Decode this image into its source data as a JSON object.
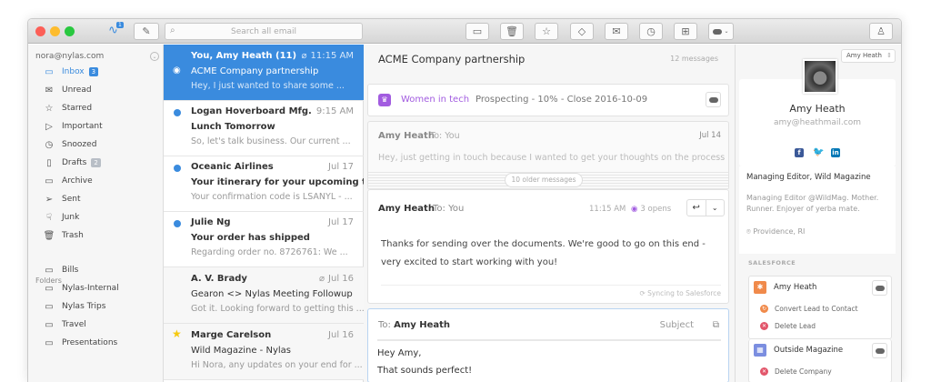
{
  "toolbar": {
    "activity_badge": "1",
    "search_placeholder": "Search all email"
  },
  "sidebar": {
    "account": "nora@nylas.com",
    "items": [
      {
        "label": "Inbox",
        "badge": "3",
        "icon": "inbox-icon"
      },
      {
        "label": "Unread",
        "icon": "unread-icon"
      },
      {
        "label": "Starred",
        "icon": "star-icon"
      },
      {
        "label": "Important",
        "icon": "important-icon"
      },
      {
        "label": "Snoozed",
        "icon": "clock-icon"
      },
      {
        "label": "Drafts",
        "badge": "2",
        "icon": "draft-icon"
      },
      {
        "label": "Archive",
        "icon": "archive-icon"
      },
      {
        "label": "Sent",
        "icon": "send-icon"
      },
      {
        "label": "Junk",
        "icon": "thumbs-down-icon"
      },
      {
        "label": "Trash",
        "icon": "trash-icon"
      }
    ],
    "folders_label": "Folders",
    "folders": [
      "Bills",
      "Nylas-Internal",
      "Nylas Trips",
      "Travel",
      "Presentations"
    ]
  },
  "threads": [
    {
      "from": "You, Amy Heath (11)",
      "time": "11:15 AM",
      "subject": "ACME Company partnership",
      "snippet": "Hey, I just wanted to share some ..."
    },
    {
      "from": "Logan Hoverboard Mfg.",
      "time": "9:15 AM",
      "subject": "Lunch Tomorrow",
      "snippet": "So, let's talk business. Our current ..."
    },
    {
      "from": "Oceanic Airlines",
      "time": "Jul 17",
      "subject": "Your itinerary for your upcoming trip",
      "snippet": "Your confirmation code is LSANYL - ..."
    },
    {
      "from": "Julie Ng",
      "time": "Jul 17",
      "subject": "Your order has shipped",
      "snippet": "Regarding order no. 8726761: We ..."
    },
    {
      "from": "A. V. Brady",
      "time": "Jul 16",
      "subject": "Gearon <> Nylas Meeting Followup",
      "snippet": "Got it. Looking forward to getting this ..."
    },
    {
      "from": "Marge Carelson",
      "time": "Jul 16",
      "subject": "Wild Magazine - Nylas",
      "snippet": "Hi Nora, any updates on your end for ..."
    }
  ],
  "message": {
    "title": "ACME Company partnership",
    "count": "12 messages",
    "opportunity": {
      "name": "Women in tech",
      "status": "Prospecting - 10% - Close 2016-10-09"
    },
    "older": {
      "from": "Amy Heath",
      "to": "To: You",
      "date": "Jul 14",
      "snippet": "Hey, just getting in touch because I wanted to get your thoughts on the process",
      "older_label": "10 older messages"
    },
    "latest": {
      "from": "Amy Heath",
      "to": "To: You",
      "time": "11:15 AM",
      "opens": "3 opens",
      "body": "Thanks for sending over the documents. We're good to go on this end - very excited to start working with you!",
      "sync": "Syncing to Salesforce"
    },
    "composer": {
      "to_label": "To:",
      "to": "Amy Heath",
      "subject_label": "Subject",
      "line1": "Hey Amy,",
      "line2": "That sounds perfect!"
    }
  },
  "contact": {
    "selector": "Amy Heath",
    "name": "Amy Heath",
    "email": "amy@heathmail.com",
    "title": "Managing Editor, Wild Magazine",
    "bio": "Managing Editor @WildMag. Mother. Runner. Enjoyer of yerba mate.",
    "location": "Providence, RI",
    "salesforce_label": "SALESFORCE",
    "lead": {
      "name": "Amy Heath",
      "actions": [
        "Convert Lead to Contact",
        "Delete Lead"
      ]
    },
    "company": {
      "name": "Outside Magazine",
      "actions": [
        "Delete Company"
      ]
    }
  },
  "colors": {
    "accent": "#3a8bde",
    "purple": "#a25ce0"
  }
}
